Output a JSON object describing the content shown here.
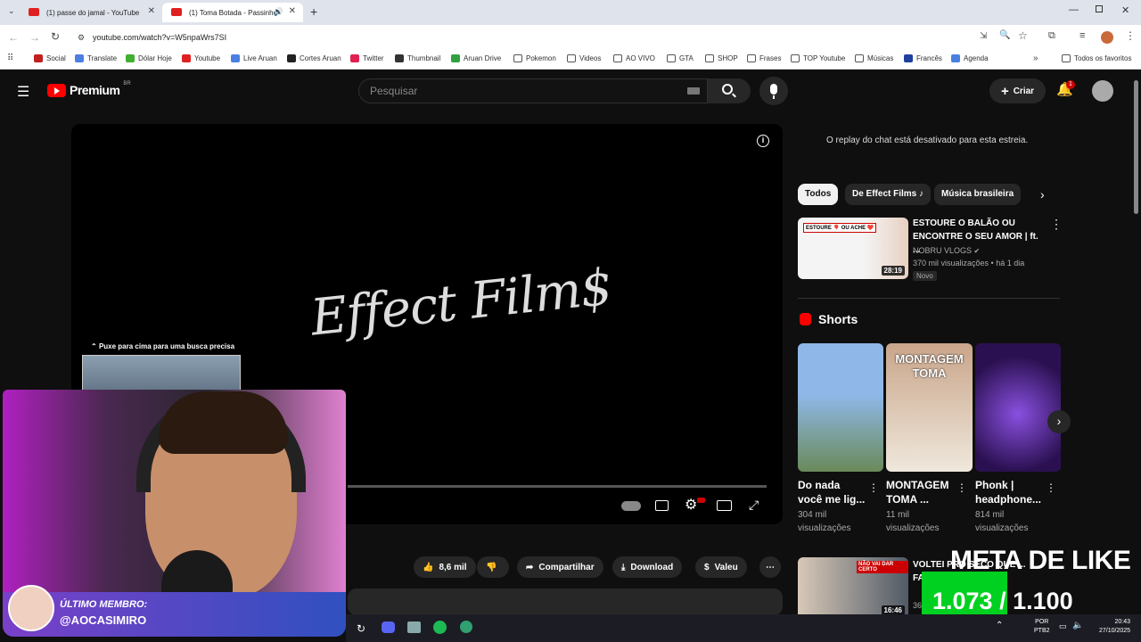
{
  "browser": {
    "tabs": [
      {
        "title": "(1) passe do jamal - YouTube",
        "close": "✕"
      },
      {
        "title": "(1) Toma Botada - Passinho",
        "close": "✕"
      }
    ],
    "new_tab": "+",
    "url": "youtube.com/watch?v=W5npaWrs7SI",
    "bookmarks": [
      "Social",
      "Translate",
      "Dólar Hoje",
      "Youtube",
      "Live Aruan",
      "Cortes Aruan",
      "Twitter",
      "Thumbnail",
      "Aruan Drive",
      "Pokemon",
      "Videos",
      "AO VIVO",
      "GTA",
      "SHOP",
      "Frases",
      "TOP Youtube",
      "Músicas",
      "Francês",
      "Agenda"
    ],
    "all_favorites": "Todos os favoritos"
  },
  "youtube": {
    "logo": "Premium",
    "region": "BR",
    "search_placeholder": "Pesquisar",
    "create_label": "Criar",
    "notification_count": "1",
    "chat_notice": "O replay do chat está desativado para esta estreia.",
    "chips": [
      "Todos",
      "De Effect Films ♪",
      "Música brasileira"
    ],
    "player": {
      "brand_text": "Effect Film$",
      "search_hint": "Puxe para cima para uma busca precisa"
    },
    "actions": {
      "likes": "8,6 mil",
      "share": "Compartilhar",
      "download": "Download",
      "thanks": "Valeu"
    },
    "recommended": {
      "title": "ESTOURE O BALÃO OU ENCONTRE O SEU AMOR | ft. ...",
      "channel": "NOBRU VLOGS",
      "stats": "370 mil visualizações • há 1 dia",
      "badge": "Novo",
      "duration": "28:19",
      "thumb_caption": "ESTOURE 🎈 OU ACHE ❤️"
    },
    "shorts_header": "Shorts",
    "shorts": [
      {
        "title": "Do nada você me lig...",
        "views": "304 mil visualizações"
      },
      {
        "title": "MONTAGEM TOMA ...",
        "views": "11 mil visualizações",
        "thumb_text": "MONTAGEM TOMA"
      },
      {
        "title": "Phonk | headphone...",
        "views": "814 mil visualizações"
      }
    ],
    "next_video": {
      "title": "VOLTEI PRO SECO QUE ... FA...",
      "stats": "36...",
      "duration": "16:46",
      "thumb_caption": "NÃO VAI DAR CERTO"
    }
  },
  "overlay": {
    "goal_label": "META DE LIKE",
    "goal_count": "1.073 / 1.100",
    "member_label": "ÚLTIMO MEMBRO:",
    "member_name": "@AOCASIMIRO"
  },
  "taskbar": {
    "lang": "POR",
    "layout": "PTB2",
    "time": "20:43",
    "date": "27/10/2025"
  },
  "colors": {
    "yt_red": "#ff0000",
    "yt_bg": "#0f0f0f",
    "chip_bg": "#272727",
    "goal_green": "#00d020"
  }
}
